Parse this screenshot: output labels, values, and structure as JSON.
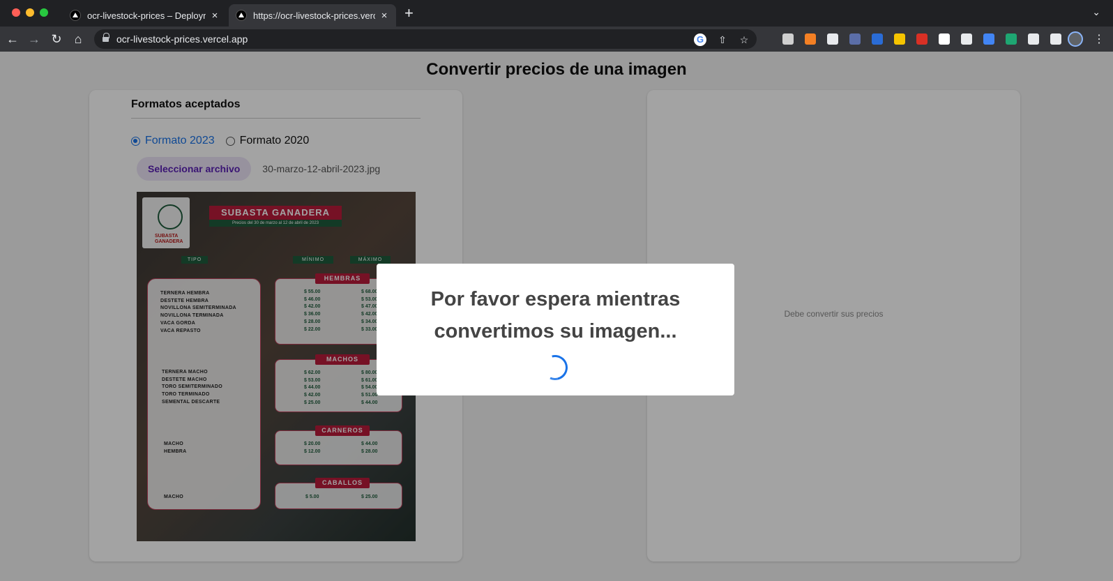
{
  "browser": {
    "tabs": [
      {
        "title": "ocr-livestock-prices – Deployment",
        "active": false
      },
      {
        "title": "https://ocr-livestock-prices.vercel.app",
        "active": true
      }
    ],
    "new_tab_label": "+",
    "close_label": "×",
    "url": "ocr-livestock-prices.vercel.app",
    "extension_colors": [
      "#cfcfcf",
      "#f48024",
      "#e8eaed",
      "#5b6ea8",
      "#2a6cd6",
      "#f5c400",
      "#d93025",
      "#ffffff",
      "#e8eaed",
      "#4285f4",
      "#1ea672",
      "#e8eaed",
      "#e8eaed"
    ]
  },
  "page": {
    "title": "Convertir precios de una imagen",
    "left_card": {
      "section_title": "Formatos aceptados",
      "radios": [
        {
          "label": "Formato 2023",
          "checked": true
        },
        {
          "label": "Formato 2020",
          "checked": false
        }
      ],
      "file_button": "Seleccionar archivo",
      "file_name": "30-marzo-12-abril-2023.jpg"
    },
    "right_card": {
      "placeholder": "Debe convertir sus precios"
    }
  },
  "flyer": {
    "logo_text": "SUBASTA\nGANADERA",
    "banner": "SUBASTA GANADERA",
    "subtitle": "Precios del 30 de marzo al 12 de abril de 2023",
    "col_tipo": "TIPO",
    "col_min": "MÍNIMO",
    "col_max": "MÁXIMO",
    "sections": [
      {
        "name": "HEMBRAS",
        "items": [
          "TERNERA HEMBRA",
          "DESTETE HEMBRA",
          "NOVILLONA SEMITERMINADA",
          "NOVILLONA TERMINADA",
          "VACA GORDA",
          "VACA REPASTO"
        ],
        "min": [
          "$ 55.00",
          "$ 46.00",
          "$ 42.00",
          "$ 36.00",
          "$ 28.00",
          "$ 22.00"
        ],
        "max": [
          "$ 68.00",
          "$ 53.00",
          "$ 47.00",
          "$ 42.00",
          "$ 34.00",
          "$ 33.00"
        ]
      },
      {
        "name": "MACHOS",
        "items": [
          "TERNERA MACHO",
          "DESTETE MACHO",
          "TORO SEMITERMINADO",
          "TORO TERMINADO",
          "SEMENTAL DESCARTE"
        ],
        "min": [
          "$ 62.00",
          "$ 53.00",
          "$ 44.00",
          "$ 42.00",
          "$ 25.00"
        ],
        "max": [
          "$ 80.00",
          "$ 61.00",
          "$ 54.00",
          "$ 51.00",
          "$ 44.00"
        ]
      },
      {
        "name": "CARNEROS",
        "items": [
          "MACHO",
          "HEMBRA"
        ],
        "min": [
          "$ 20.00",
          "$ 12.00"
        ],
        "max": [
          "$ 44.00",
          "$ 28.00"
        ]
      },
      {
        "name": "CABALLOS",
        "items": [
          "MACHO"
        ],
        "min": [
          "$ 5.00"
        ],
        "max": [
          "$ 25.00"
        ]
      }
    ]
  },
  "modal": {
    "message": "Por favor espera mientras convertimos su imagen..."
  }
}
